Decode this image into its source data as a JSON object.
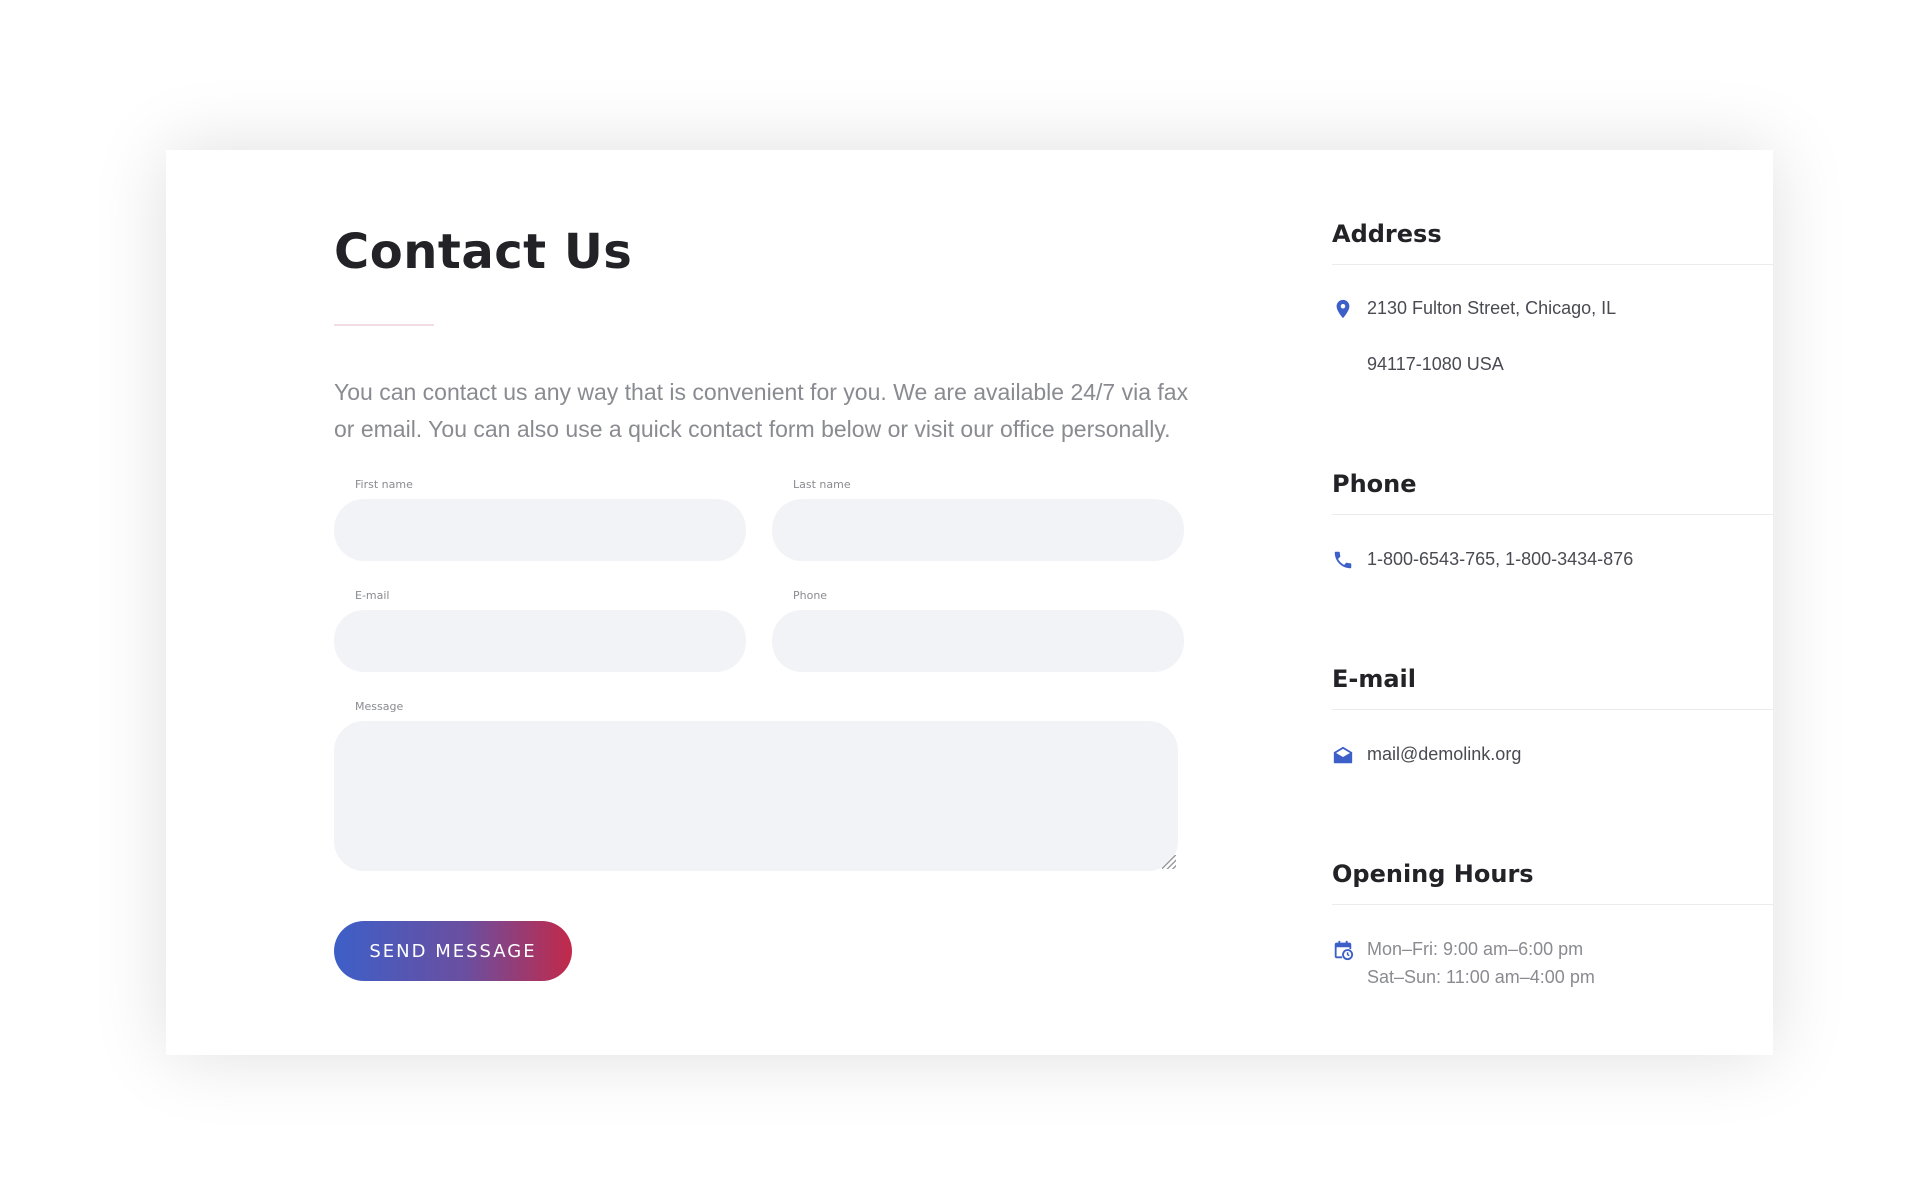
{
  "contact_form": {
    "title": "Contact Us",
    "intro": "You can contact us any way that is convenient for you. We are available 24/7 via fax or email. You can also use a quick contact form below or visit our office personally.",
    "first_name_label": "First name",
    "last_name_label": "Last name",
    "email_label": "E-mail",
    "phone_label": "Phone",
    "message_label": "Message",
    "first_name_value": "",
    "last_name_value": "",
    "email_value": "",
    "phone_value": "",
    "message_value": "",
    "submit_label": "SEND MESSAGE"
  },
  "info": {
    "address": {
      "title": "Address",
      "icon": "map-pin-icon",
      "line1": "2130 Fulton Street, Chicago, IL",
      "line2": "94117-1080 USA"
    },
    "phone": {
      "title": "Phone",
      "icon": "phone-icon",
      "text": "1-800-6543-765,  1-800-3434-876"
    },
    "email": {
      "title": "E-mail",
      "icon": "envelope-open-icon",
      "text": "mail@demolink.org"
    },
    "hours": {
      "title": "Opening Hours",
      "icon": "calendar-clock-icon",
      "line1": "Mon–Fri: 9:00 am–6:00 pm",
      "line2": "Sat–Sun: 11:00 am–4:00 pm"
    }
  },
  "colors": {
    "accent": "#3d5fc8",
    "gradient_start": "#3d5fc8",
    "gradient_end": "#c2294a",
    "field_bg": "#f2f3f7",
    "heading": "#222227"
  }
}
